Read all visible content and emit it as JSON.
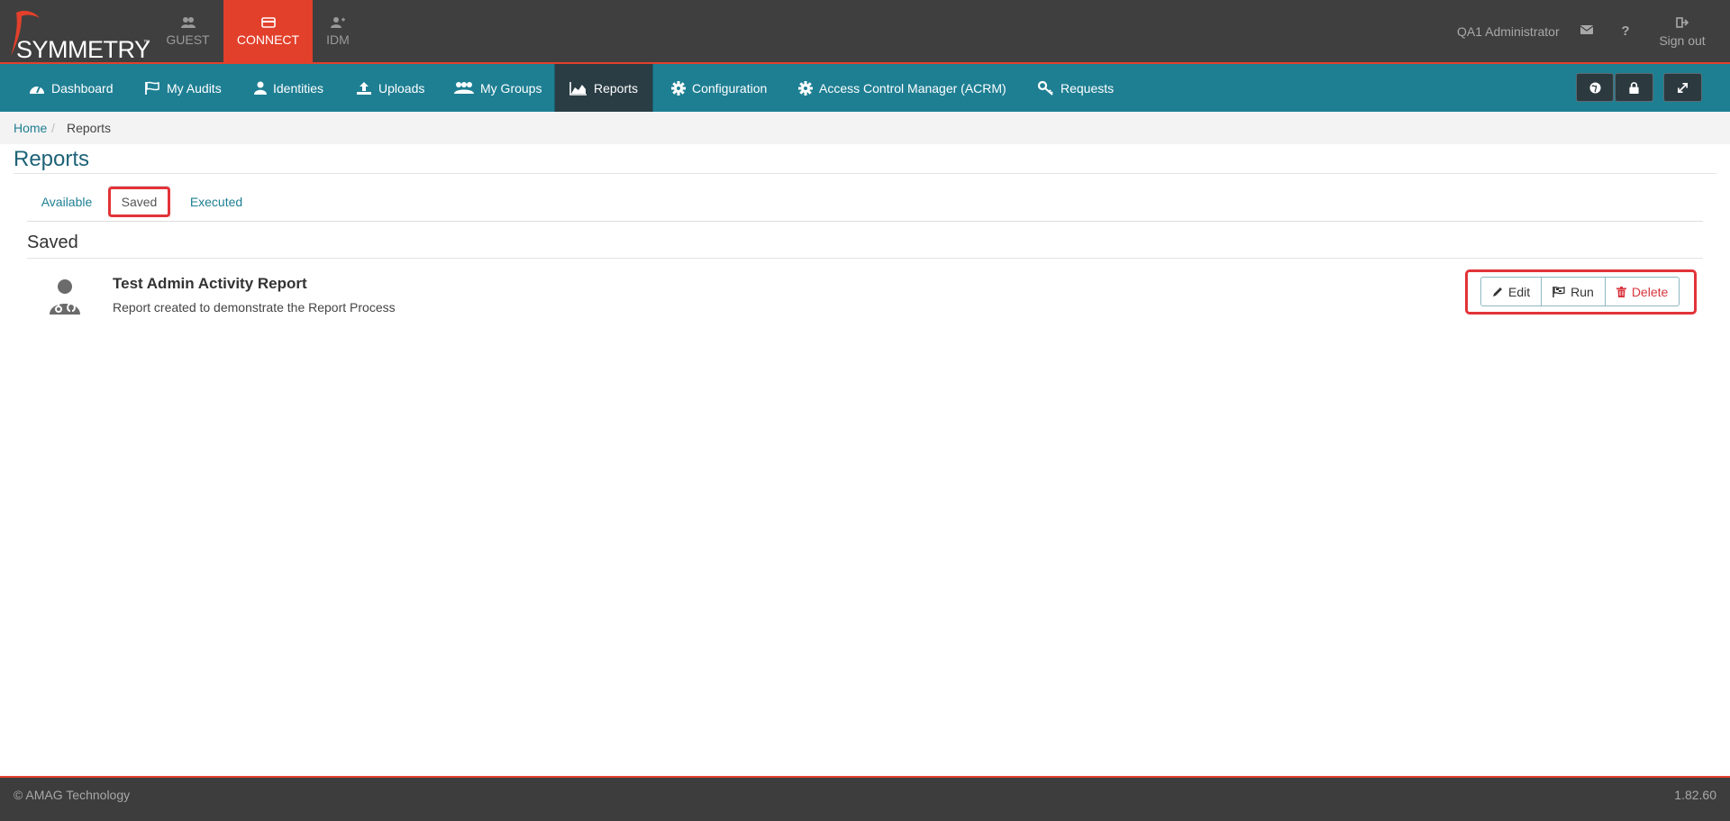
{
  "brand": {
    "logo_text": "SYMMETRY",
    "trademark": "™"
  },
  "app_tabs": [
    {
      "label": "GUEST",
      "icon": "users-icon"
    },
    {
      "label": "CONNECT",
      "icon": "card-icon",
      "active": true
    },
    {
      "label": "IDM",
      "icon": "user-plus-icon"
    }
  ],
  "header": {
    "user": "QA1 Administrator",
    "signout": "Sign out"
  },
  "nav": {
    "items": [
      {
        "label": "Dashboard",
        "icon": "dashboard-icon"
      },
      {
        "label": "My Audits",
        "icon": "flag-icon"
      },
      {
        "label": "Identities",
        "icon": "user-icon"
      },
      {
        "label": "Uploads",
        "icon": "upload-icon"
      },
      {
        "label": "My Groups",
        "icon": "group-icon"
      },
      {
        "label": "Reports",
        "icon": "area-chart-icon",
        "active": true
      },
      {
        "label": "Configuration",
        "icon": "gear-icon"
      },
      {
        "label": "Access Control Manager (ACRM)",
        "icon": "gear-icon"
      },
      {
        "label": "Requests",
        "icon": "key-icon"
      }
    ]
  },
  "breadcrumb": {
    "home": "Home",
    "separator": "/",
    "current": "Reports"
  },
  "page": {
    "title": "Reports",
    "tabs": [
      {
        "label": "Available"
      },
      {
        "label": "Saved",
        "active": true
      },
      {
        "label": "Executed"
      }
    ],
    "section_title": "Saved"
  },
  "report": {
    "name": "Test Admin Activity Report",
    "description": "Report created to demonstrate the Report Process",
    "actions": {
      "edit": "Edit",
      "run": "Run",
      "delete": "Delete"
    }
  },
  "footer": {
    "copyright": "© AMAG Technology",
    "version": "1.82.60"
  },
  "colors": {
    "topbar": "#3f3f3f",
    "accent": "#e2402b",
    "nav": "#1e7f93",
    "nav_active": "#2a3d45",
    "highlight": "#e23338"
  }
}
